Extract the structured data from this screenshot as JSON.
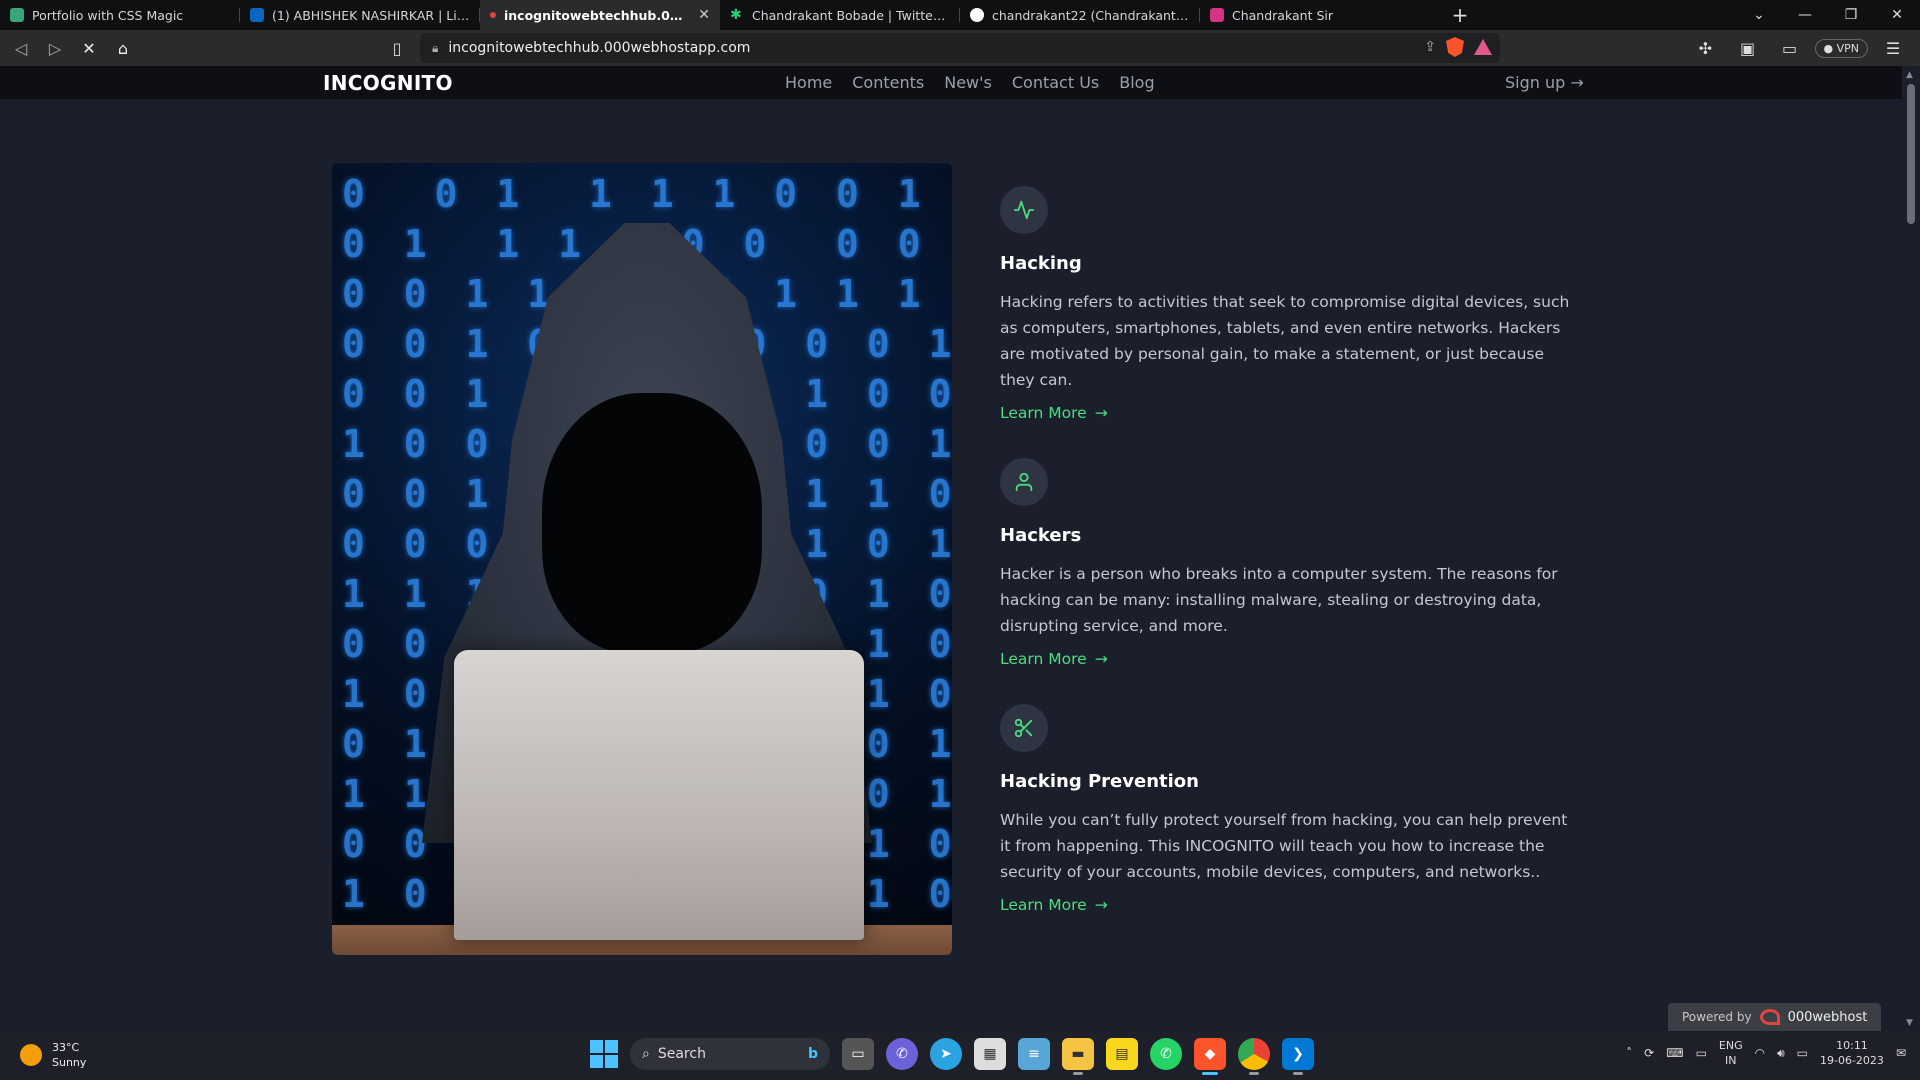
{
  "browser": {
    "tabs": [
      {
        "label": "Portfolio with CSS Magic",
        "color": "#3aa57a"
      },
      {
        "label": "(1) ABHISHEK NASHIRKAR | LinkedIn",
        "color": "#0a66c2"
      },
      {
        "label": "incognitowebtechhub.000webhos",
        "color": "#e0463e",
        "active": true
      },
      {
        "label": "Chandrakant Bobade | Twitter, Instagr",
        "color": "#2ecc71"
      },
      {
        "label": "chandrakant22 (Chandrakant Bobade)",
        "color": "#ffffff"
      },
      {
        "label": "Chandrakant Sir",
        "color": "#d63384"
      }
    ],
    "url": "incognitowebtechhub.000webhostapp.com",
    "vpn_label": "VPN"
  },
  "site": {
    "brand": "INCOGNITO",
    "nav": [
      "Home",
      "Contents",
      "New's",
      "Contact Us",
      "Blog"
    ],
    "signup": "Sign up",
    "features": [
      {
        "icon": "activity-icon",
        "title": "Hacking",
        "desc": "Hacking refers to activities that seek to compromise digital devices, such as computers, smartphones, tablets, and even entire networks. Hackers are motivated by personal gain, to make a statement, or just because they can.",
        "link": "Learn More"
      },
      {
        "icon": "user-icon",
        "title": "Hackers",
        "desc": "Hacker is a person who breaks into a computer system. The reasons for hacking can be many: installing malware, stealing or destroying data, disrupting service, and more.",
        "link": "Learn More"
      },
      {
        "icon": "scissors-icon",
        "title": "Hacking Prevention",
        "desc": "While you can’t fully protect yourself from hacking, you can help prevent it from happening. This INCOGNITO will teach you how to increase the security of your accounts, mobile devices, computers, and networks..",
        "link": "Learn More"
      }
    ],
    "powered_by": "Powered by",
    "host_brand": "000webhost"
  },
  "taskbar": {
    "temp": "33°C",
    "condition": "Sunny",
    "search": "Search",
    "lang_top": "ENG",
    "lang_bottom": "IN",
    "time": "10:11",
    "date": "19-06-2023"
  },
  "colors": {
    "accent": "#4ade80",
    "page_bg": "#1b1f2b",
    "nav_bg": "#0d0f14"
  }
}
